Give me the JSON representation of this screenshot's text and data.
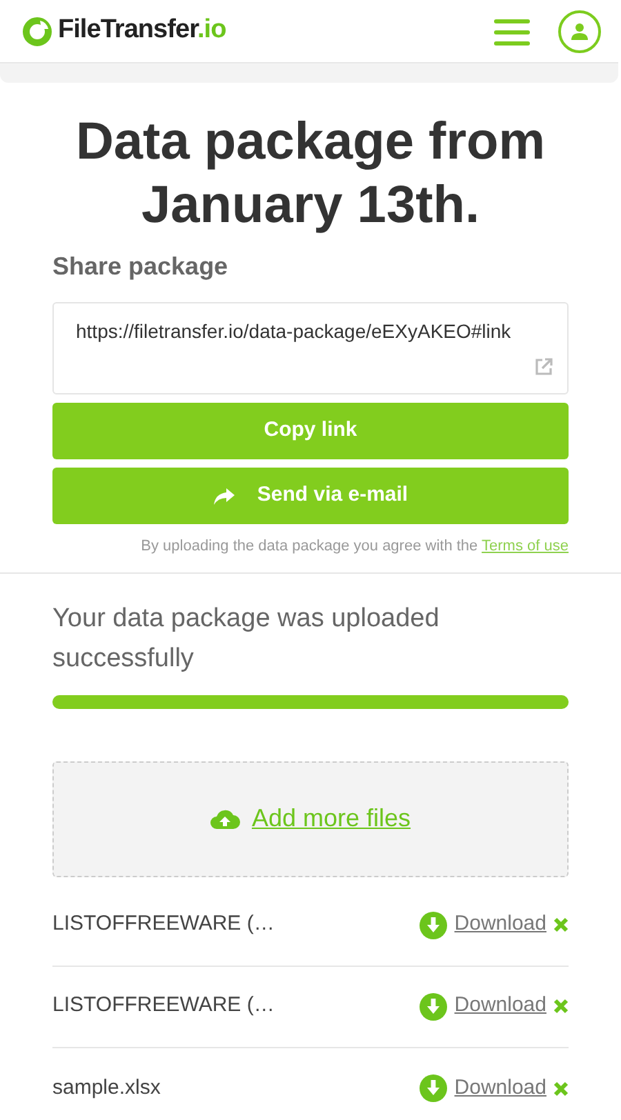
{
  "header": {
    "logo_name": "FileTransfer",
    "logo_suffix": ".io"
  },
  "title": "Data package from January 13th.",
  "share": {
    "heading": "Share package",
    "link": "https://filetransfer.io/data-package/eEXyAKEO#link",
    "copy_button": "Copy link",
    "email_button": "Send via e-mail",
    "terms_text": "By uploading the data package you agree with the",
    "terms_link": "Terms of use"
  },
  "upload": {
    "message": "Your data package was uploaded successfully",
    "level": 1
  },
  "add_files": "Add more files",
  "files": [
    {
      "name": "LISTOFFREEWARE (…",
      "action": "Download"
    },
    {
      "name": "LISTOFFREEWARE (…",
      "action": "Download"
    },
    {
      "name": "sample.xlsx",
      "action": "Download"
    }
  ]
}
